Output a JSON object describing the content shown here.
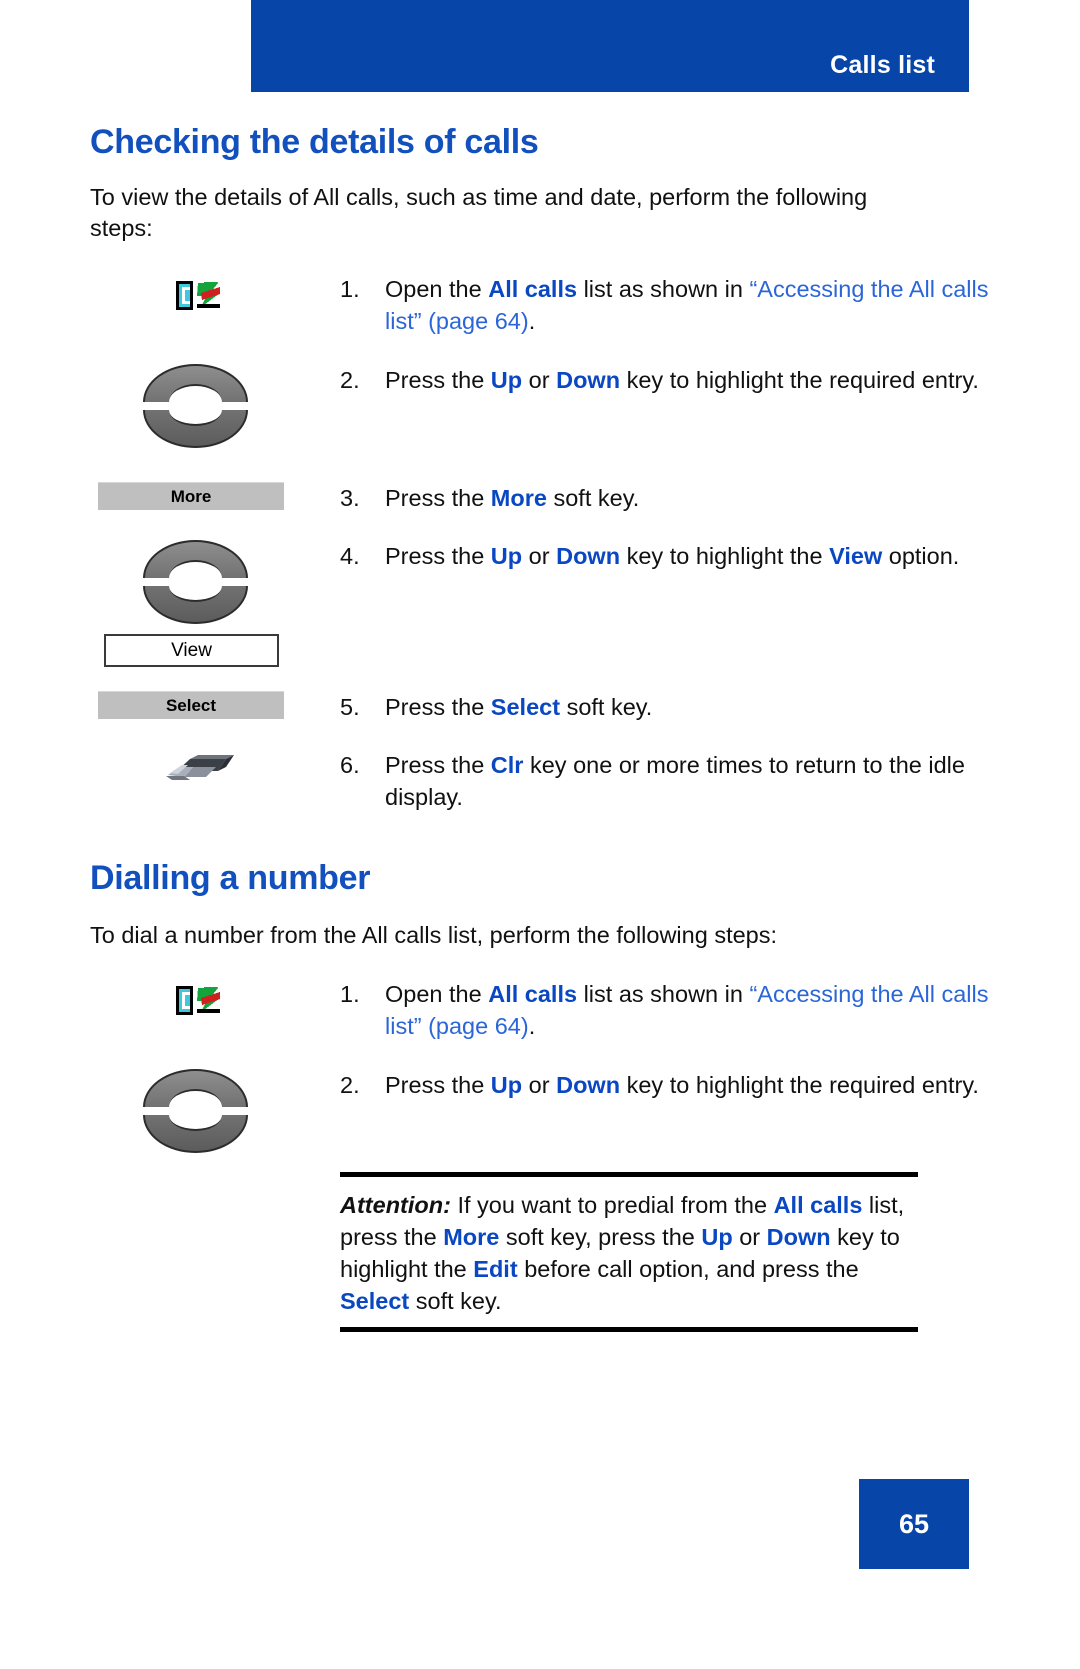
{
  "header": {
    "title": "Calls list",
    "banner_color": "#0746A8"
  },
  "footer": {
    "page_number": "65",
    "banner_color": "#0746A8"
  },
  "colors": {
    "heading_blue": "#1250BE",
    "keyword_blue": "#0A47C2",
    "crossref_blue": "#2B66D9",
    "softkey_gray": "#BFBFBF"
  },
  "sections": [
    {
      "heading": "Checking the details of calls",
      "intro": "To view the details of All calls, such as time and date, perform the following steps:",
      "steps": [
        {
          "num": "1.",
          "graphic": "phone-calls-list-icon",
          "text_parts": [
            {
              "t": "Open the ",
              "s": "plain"
            },
            {
              "t": "All calls",
              "s": "keyword"
            },
            {
              "t": " list as shown in ",
              "s": "plain"
            },
            {
              "t": "“Accessing the All calls list” (page 64)",
              "s": "xref"
            },
            {
              "t": ".",
              "s": "plain"
            }
          ]
        },
        {
          "num": "2.",
          "graphic": "navigation-updown-key",
          "text_parts": [
            {
              "t": "Press the ",
              "s": "plain"
            },
            {
              "t": "Up",
              "s": "keyword"
            },
            {
              "t": " or ",
              "s": "plain"
            },
            {
              "t": "Down",
              "s": "keyword"
            },
            {
              "t": " key to highlight the required entry.",
              "s": "plain"
            }
          ]
        },
        {
          "num": "3.",
          "graphic": "softkey-more",
          "graphic_label": "More",
          "text_parts": [
            {
              "t": "Press the ",
              "s": "plain"
            },
            {
              "t": "More",
              "s": "keyword"
            },
            {
              "t": " soft key.",
              "s": "plain"
            }
          ]
        },
        {
          "num": "4.",
          "graphic": "navigation-updown-key-with-view-box",
          "graphic_label": "View",
          "text_parts": [
            {
              "t": "Press the ",
              "s": "plain"
            },
            {
              "t": "Up",
              "s": "keyword"
            },
            {
              "t": " or ",
              "s": "plain"
            },
            {
              "t": "Down",
              "s": "keyword"
            },
            {
              "t": " key to highlight the ",
              "s": "plain"
            },
            {
              "t": "View",
              "s": "keyword"
            },
            {
              "t": " option.",
              "s": "plain"
            }
          ]
        },
        {
          "num": "5.",
          "graphic": "softkey-select",
          "graphic_label": "Select",
          "text_parts": [
            {
              "t": "Press the ",
              "s": "plain"
            },
            {
              "t": "Select",
              "s": "keyword"
            },
            {
              "t": " soft key.",
              "s": "plain"
            }
          ]
        },
        {
          "num": "6.",
          "graphic": "clr-key-icon",
          "text_parts": [
            {
              "t": "Press the ",
              "s": "plain"
            },
            {
              "t": "Clr",
              "s": "keyword"
            },
            {
              "t": " key one or more times to return to the idle display.",
              "s": "plain"
            }
          ]
        }
      ]
    },
    {
      "heading": "Dialling a number",
      "intro": "To dial a number from the All calls list, perform the following steps:",
      "steps": [
        {
          "num": "1.",
          "graphic": "phone-calls-list-icon",
          "text_parts": [
            {
              "t": "Open the ",
              "s": "plain"
            },
            {
              "t": "All calls",
              "s": "keyword"
            },
            {
              "t": " list as shown in ",
              "s": "plain"
            },
            {
              "t": "“Accessing the All calls list” (page 64)",
              "s": "xref"
            },
            {
              "t": ".",
              "s": "plain"
            }
          ]
        },
        {
          "num": "2.",
          "graphic": "navigation-updown-key",
          "text_parts": [
            {
              "t": "Press the ",
              "s": "plain"
            },
            {
              "t": "Up",
              "s": "keyword"
            },
            {
              "t": " or ",
              "s": "plain"
            },
            {
              "t": "Down",
              "s": "keyword"
            },
            {
              "t": " key to highlight the required entry.",
              "s": "plain"
            }
          ]
        }
      ]
    }
  ],
  "attention": {
    "lead": "Attention:",
    "text_parts": [
      {
        "t": " If you want to predial from the ",
        "s": "plain"
      },
      {
        "t": "All calls",
        "s": "keyword"
      },
      {
        "t": " list, press the ",
        "s": "plain"
      },
      {
        "t": "More",
        "s": "keyword"
      },
      {
        "t": " soft key, press the ",
        "s": "plain"
      },
      {
        "t": "Up",
        "s": "keyword"
      },
      {
        "t": " or ",
        "s": "plain"
      },
      {
        "t": "Down",
        "s": "keyword"
      },
      {
        "t": " key to highlight the ",
        "s": "plain"
      },
      {
        "t": "Edit",
        "s": "keyword"
      },
      {
        "t": " before call option, and press the ",
        "s": "plain"
      },
      {
        "t": "Select",
        "s": "keyword"
      },
      {
        "t": " soft key.",
        "s": "plain"
      }
    ]
  }
}
